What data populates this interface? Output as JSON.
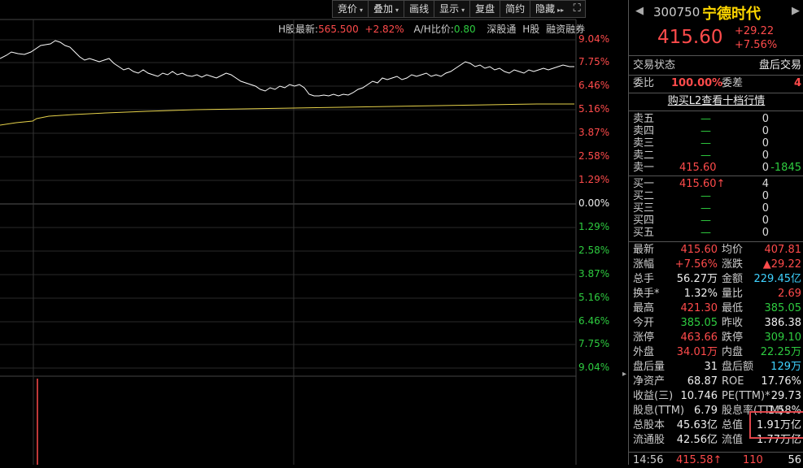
{
  "toolbar": {
    "items": [
      {
        "label": "竞价",
        "arrow": true
      },
      {
        "label": "叠加",
        "arrow": true
      },
      {
        "label": "画线",
        "arrow": false
      },
      {
        "label": "显示",
        "arrow": true
      },
      {
        "label": "复盘",
        "arrow": false
      },
      {
        "label": "简约",
        "arrow": false
      },
      {
        "label": "隐藏",
        "arrow": false
      }
    ],
    "expand_glyph": "▸▸",
    "fullscreen_glyph": "⛶"
  },
  "info": {
    "h_label": "H股最新:",
    "h_price": "565.500",
    "h_change": "+2.82%",
    "ah_label": "A/H比价:",
    "ah_value": "0.80",
    "shgt": "深股通",
    "h": "H股",
    "margin": "融资融券"
  },
  "axis_pct": [
    "9.04%",
    "7.75%",
    "6.46%",
    "5.16%",
    "3.87%",
    "2.58%",
    "1.29%",
    "0.00%",
    "1.29%",
    "2.58%",
    "3.87%",
    "5.16%",
    "6.46%",
    "7.75%",
    "9.04%"
  ],
  "header": {
    "code": "300750",
    "name": "宁德时代",
    "price": "415.60",
    "change": "+29.22",
    "change_pct": "+7.56%"
  },
  "status": {
    "label": "交易状态",
    "value": "盘后交易"
  },
  "ratio": {
    "wb_label": "委比",
    "wb_value": "100.00%",
    "wc_label": "委差",
    "wc_value": "4"
  },
  "l2_link": "购买L2查看十档行情",
  "sell": [
    {
      "label": "卖五",
      "price": "—",
      "vol": "0"
    },
    {
      "label": "卖四",
      "price": "—",
      "vol": "0"
    },
    {
      "label": "卖三",
      "price": "—",
      "vol": "0"
    },
    {
      "label": "卖二",
      "price": "—",
      "vol": "0"
    },
    {
      "label": "卖一",
      "price": "415.60",
      "vol": "0",
      "diff": "-1845"
    }
  ],
  "buy": [
    {
      "label": "买一",
      "price": "415.60↑",
      "vol": "4"
    },
    {
      "label": "买二",
      "price": "—",
      "vol": "0"
    },
    {
      "label": "买三",
      "price": "—",
      "vol": "0"
    },
    {
      "label": "买四",
      "price": "—",
      "vol": "0"
    },
    {
      "label": "买五",
      "price": "—",
      "vol": "0"
    }
  ],
  "stats": [
    {
      "l1": "最新",
      "v1": "415.60",
      "c1": "red",
      "l2": "均价",
      "v2": "407.81",
      "c2": "red"
    },
    {
      "l1": "涨幅",
      "v1": "+7.56%",
      "c1": "red",
      "l2": "涨跌",
      "v2": "▲29.22",
      "c2": "red"
    },
    {
      "l1": "总手",
      "v1": "56.27万",
      "c1": "white",
      "l2": "金额",
      "v2": "229.45亿",
      "c2": "cyan"
    },
    {
      "l1": "换手*",
      "v1": "1.32%",
      "c1": "white",
      "l2": "量比",
      "v2": "2.69",
      "c2": "red"
    },
    {
      "l1": "最高",
      "v1": "421.30",
      "c1": "red",
      "l2": "最低",
      "v2": "385.05",
      "c2": "green"
    },
    {
      "l1": "今开",
      "v1": "385.05",
      "c1": "green",
      "l2": "昨收",
      "v2": "386.38",
      "c2": "white"
    },
    {
      "l1": "涨停",
      "v1": "463.66",
      "c1": "red",
      "l2": "跌停",
      "v2": "309.10",
      "c2": "green"
    },
    {
      "l1": "外盘",
      "v1": "34.01万",
      "c1": "red",
      "l2": "内盘",
      "v2": "22.25万",
      "c2": "green"
    },
    {
      "l1": "盘后量",
      "v1": "31",
      "c1": "white",
      "l2": "盘后额",
      "v2": "129万",
      "c2": "cyan"
    },
    {
      "l1": "净资产",
      "v1": "68.87",
      "c1": "white",
      "l2": "ROE",
      "v2": "17.76%",
      "c2": "white"
    },
    {
      "l1": "收益(三)",
      "v1": "10.746",
      "c1": "white",
      "l2": "PE(TTM)*",
      "v2": "29.73",
      "c2": "white"
    },
    {
      "l1": "股息(TTM)",
      "v1": "6.79",
      "c1": "white",
      "l2": "股息率(TTM)",
      "v2": "1.58%",
      "c2": "white"
    },
    {
      "l1": "总股本",
      "v1": "45.63亿",
      "c1": "white",
      "l2": "总值",
      "v2": "1.91万亿",
      "c2": "white"
    },
    {
      "l1": "流通股",
      "v1": "42.56亿",
      "c1": "white",
      "l2": "流值",
      "v2": "1.77万亿",
      "c2": "white"
    }
  ],
  "tick": {
    "time": "14:56",
    "price": "415.58↑",
    "vol": "110",
    "num": "56"
  }
}
